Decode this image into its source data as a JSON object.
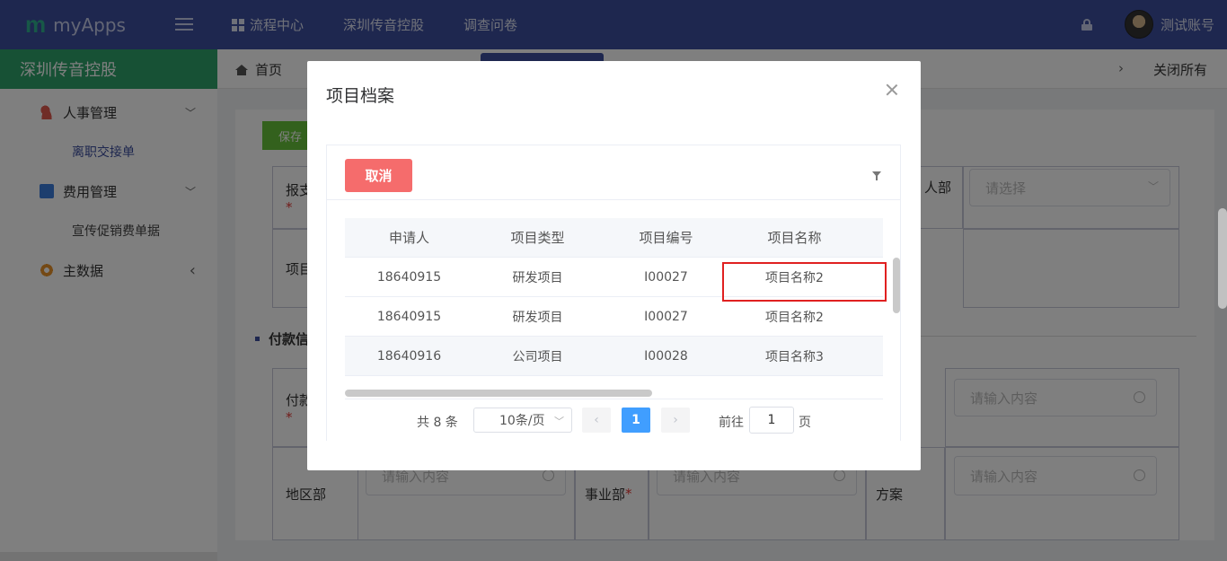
{
  "topbar": {
    "brand_logo": "m",
    "brand_name": "myApps",
    "nav": [
      "流程中心",
      "深圳传音控股",
      "调查问卷"
    ],
    "user_name": "测试账号"
  },
  "sidebar": {
    "header": "深圳传音控股",
    "items": [
      {
        "label": "人事管理",
        "chevron": "﹀"
      },
      {
        "label": "离职交接单"
      },
      {
        "label": "费用管理",
        "chevron": "﹀"
      },
      {
        "label": "宣传促销费单据"
      },
      {
        "label": "主数据",
        "chevron": "‹"
      }
    ]
  },
  "tabs": {
    "home": "首页",
    "right_arrow": "›",
    "close_all": "关闭所有"
  },
  "form": {
    "save_label": "保存",
    "labels": {
      "reimburse": "报支",
      "project": "项目",
      "payment_section": "付款信",
      "payment": "付款",
      "region": "地区部",
      "business": "事业部",
      "plan": "方案",
      "dept": "人部"
    },
    "select_placeholder": "请选择",
    "input_placeholder": "请输入内容",
    "required_mark": "*"
  },
  "dialog": {
    "title": "项目档案",
    "cancel_label": "取消",
    "columns": [
      "申请人",
      "项目类型",
      "项目编号",
      "项目名称"
    ],
    "rows": [
      [
        "18640915",
        "研发项目",
        "I00027",
        "项目名称2"
      ],
      [
        "18640915",
        "研发项目",
        "I00027",
        "项目名称2"
      ],
      [
        "18640916",
        "公司项目",
        "I00028",
        "项目名称3"
      ]
    ],
    "pager": {
      "total": "共 8 条",
      "page_size": "10条/页",
      "prev": "‹",
      "current": "1",
      "next": "›",
      "goto_label": "前往",
      "goto_value": "1",
      "page_unit": "页"
    }
  },
  "colors": {
    "topbar": "#3d4e9e",
    "sidebar_header": "#2fa36b",
    "cancel_button": "#f56c6c",
    "pager_active": "#409eff",
    "highlight": "#e02020"
  }
}
